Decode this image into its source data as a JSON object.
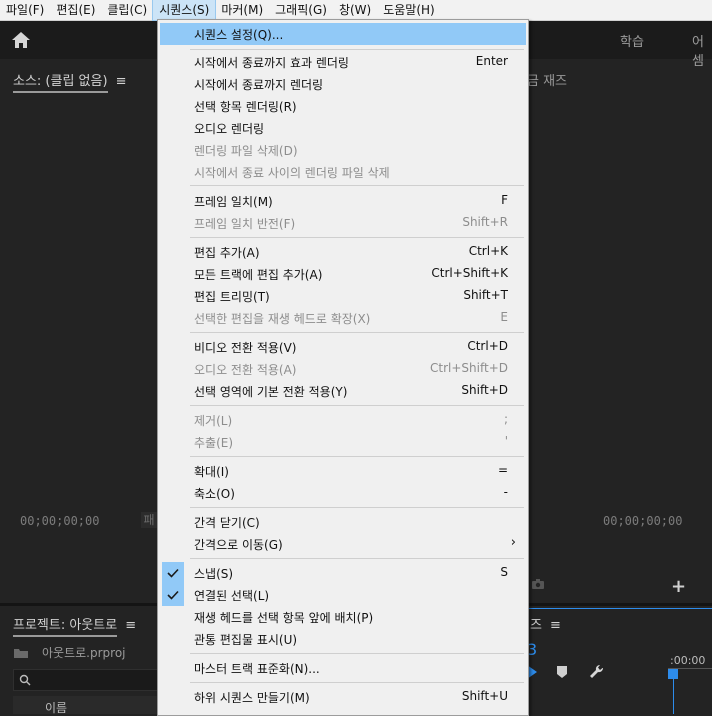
{
  "menubar": {
    "items": [
      "파일(F)",
      "편집(E)",
      "클립(C)",
      "시퀀스(S)",
      "마커(M)",
      "그래픽(G)",
      "창(W)",
      "도움말(H)"
    ]
  },
  "header": {
    "workspace_tabs": [
      "학습",
      "어셈"
    ]
  },
  "source_panel": {
    "title": "소스: (클립 없음)",
    "timecode_left": "00;00;00;00",
    "partial_text": "패"
  },
  "program_panel": {
    "title_partial": "금 재즈",
    "timecode_right": "00;00;00;00"
  },
  "project_panel": {
    "title": "프로젝트: 아웃트로",
    "file_name": "아웃트로.prproj",
    "column_name": "이름"
  },
  "timeline_panel": {
    "title_partial": "즈",
    "timecode_partial": "3",
    "ruler_label": ":00:00"
  },
  "sequence_menu": {
    "items": [
      {
        "label": "시퀀스 설정(Q)...",
        "shortcut": "",
        "disabled": false,
        "highlight": true
      },
      {
        "label": "시작에서 종료까지 효과 렌더링",
        "shortcut": "Enter",
        "disabled": false
      },
      {
        "label": "시작에서 종료까지 렌더링",
        "shortcut": "",
        "disabled": false
      },
      {
        "label": "선택 항목 렌더링(R)",
        "shortcut": "",
        "disabled": false
      },
      {
        "label": "오디오 렌더링",
        "shortcut": "",
        "disabled": false
      },
      {
        "label": "렌더링 파일 삭제(D)",
        "shortcut": "",
        "disabled": true
      },
      {
        "label": "시작에서 종료 사이의 렌더링 파일 삭제",
        "shortcut": "",
        "disabled": true
      },
      {
        "label": "프레임 일치(M)",
        "shortcut": "F",
        "disabled": false
      },
      {
        "label": "프레임 일치 반전(F)",
        "shortcut": "Shift+R",
        "disabled": true
      },
      {
        "label": "편집 추가(A)",
        "shortcut": "Ctrl+K",
        "disabled": false
      },
      {
        "label": "모든 트랙에 편집 추가(A)",
        "shortcut": "Ctrl+Shift+K",
        "disabled": false
      },
      {
        "label": "편집 트리밍(T)",
        "shortcut": "Shift+T",
        "disabled": false
      },
      {
        "label": "선택한 편집을 재생 헤드로 확장(X)",
        "shortcut": "E",
        "disabled": true
      },
      {
        "label": "비디오 전환 적용(V)",
        "shortcut": "Ctrl+D",
        "disabled": false
      },
      {
        "label": "오디오 전환 적용(A)",
        "shortcut": "Ctrl+Shift+D",
        "disabled": true
      },
      {
        "label": "선택 영역에 기본 전환 적용(Y)",
        "shortcut": "Shift+D",
        "disabled": false
      },
      {
        "label": "제거(L)",
        "shortcut": ";",
        "disabled": true
      },
      {
        "label": "추출(E)",
        "shortcut": "'",
        "disabled": true
      },
      {
        "label": "확대(I)",
        "shortcut": "=",
        "disabled": false
      },
      {
        "label": "축소(O)",
        "shortcut": "-",
        "disabled": false
      },
      {
        "label": "간격 닫기(C)",
        "shortcut": "",
        "disabled": false
      },
      {
        "label": "간격으로 이동(G)",
        "shortcut": "",
        "disabled": false,
        "submenu": true
      },
      {
        "label": "스냅(S)",
        "shortcut": "S",
        "disabled": false,
        "checked": true
      },
      {
        "label": "연결된 선택(L)",
        "shortcut": "",
        "disabled": false,
        "checked": true
      },
      {
        "label": "재생 헤드를 선택 항목 앞에 배치(P)",
        "shortcut": "",
        "disabled": false
      },
      {
        "label": "관통 편집물 표시(U)",
        "shortcut": "",
        "disabled": false
      },
      {
        "label": "마스터 트랙 표준화(N)...",
        "shortcut": "",
        "disabled": false
      },
      {
        "label": "하위 시퀀스 만들기(M)",
        "shortcut": "Shift+U",
        "disabled": false
      }
    ]
  },
  "colors": {
    "accent": "#2d8ceb",
    "menu_highlight": "#91c9f7"
  }
}
